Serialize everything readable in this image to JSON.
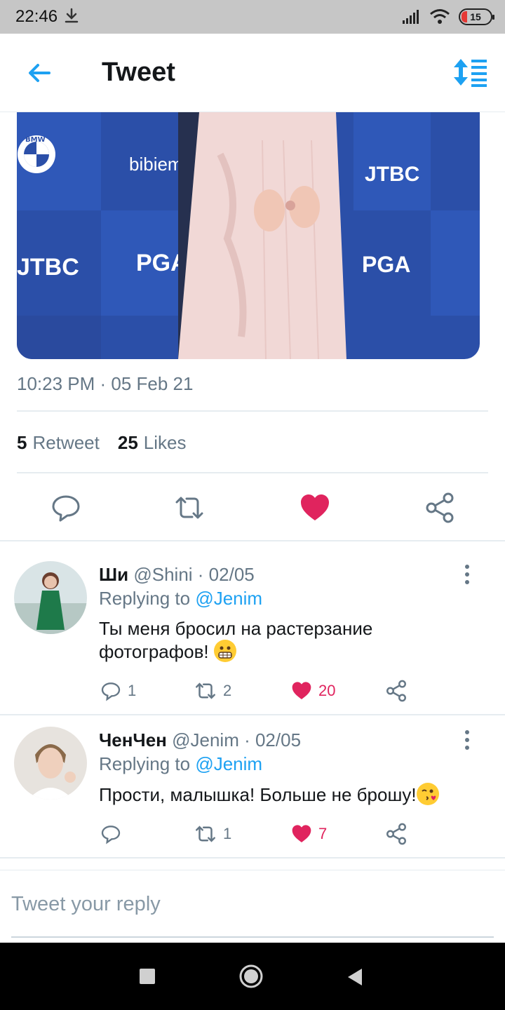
{
  "status_bar": {
    "time": "22:46",
    "battery": "15"
  },
  "header": {
    "title": "Tweet"
  },
  "tweet": {
    "timestamp": "10:23 PM · 05 Feb 21",
    "retweets_count": "5",
    "retweets_label": "Retweet",
    "likes_count": "25",
    "likes_label": "Likes",
    "media_text": {
      "bmw": "BMW",
      "bibiem": "bibiem",
      "jtbc": "JTBC",
      "pga": "PGA"
    }
  },
  "replies": [
    {
      "name": "Ши",
      "handle": "@Shini · 02/05",
      "replying_prefix": "Replying to ",
      "replying_to": "@Jenim",
      "text": "Ты меня бросил на растерзание фотографов!",
      "reply_count": "1",
      "retweet_count": "2",
      "like_count": "20"
    },
    {
      "name": "ЧенЧен",
      "handle": "@Jenim · 02/05",
      "replying_prefix": "Replying to ",
      "replying_to": "@Jenim",
      "text": "Прости, малышка! Больше не брошу!",
      "reply_count": "",
      "retweet_count": "1",
      "like_count": "7"
    }
  ],
  "reply_box": {
    "placeholder": "Tweet your reply"
  },
  "colors": {
    "accent": "#1da1f2",
    "like": "#e0245e",
    "muted": "#657786"
  }
}
